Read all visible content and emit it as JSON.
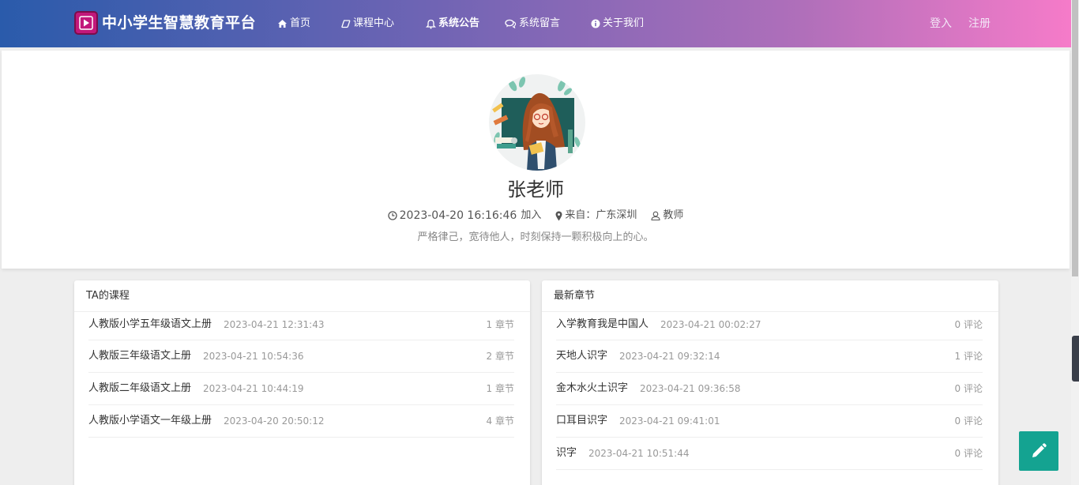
{
  "header": {
    "brand": "中小学生智慧教育平台",
    "nav": [
      {
        "label": "首页",
        "icon": "home-icon"
      },
      {
        "label": "课程中心",
        "icon": "chat-bubble-icon"
      },
      {
        "label": "系统公告",
        "icon": "bell-icon"
      },
      {
        "label": "系统留言",
        "icon": "comments-icon"
      },
      {
        "label": "关于我们",
        "icon": "info-circle-icon"
      }
    ],
    "login": "登入",
    "register": "注册"
  },
  "profile": {
    "name": "张老师",
    "joined_time": "2023-04-20 16:16:46",
    "joined_suffix": "加入",
    "from": "来自：广东深圳",
    "role": "教师",
    "motto": "严格律己，宽待他人，时刻保持一颗积极向上的心。"
  },
  "courses": {
    "title": "TA的课程",
    "items": [
      {
        "title": "人教版小学五年级语文上册",
        "date": "2023-04-21 12:31:43",
        "count": "1 章节"
      },
      {
        "title": "人教版三年级语文上册",
        "date": "2023-04-21 10:54:36",
        "count": "2 章节"
      },
      {
        "title": "人教版二年级语文上册",
        "date": "2023-04-21 10:44:19",
        "count": "1 章节"
      },
      {
        "title": "人教版小学语文一年级上册",
        "date": "2023-04-20 20:50:12",
        "count": "4 章节"
      }
    ]
  },
  "chapters": {
    "title": "最新章节",
    "items": [
      {
        "title": "入学教育我是中国人",
        "date": "2023-04-21 00:02:27",
        "count": "0 评论"
      },
      {
        "title": "天地人识字",
        "date": "2023-04-21 09:32:14",
        "count": "1 评论"
      },
      {
        "title": "金木水火土识字",
        "date": "2023-04-21 09:36:58",
        "count": "0 评论"
      },
      {
        "title": "口耳目识字",
        "date": "2023-04-21 09:41:01",
        "count": "0 评论"
      },
      {
        "title": "识字",
        "date": "2023-04-21 10:51:44",
        "count": "0 评论"
      }
    ]
  },
  "colors": {
    "header_start": "#2a5bab",
    "header_end": "#f67bc9",
    "fab": "#14a391"
  }
}
